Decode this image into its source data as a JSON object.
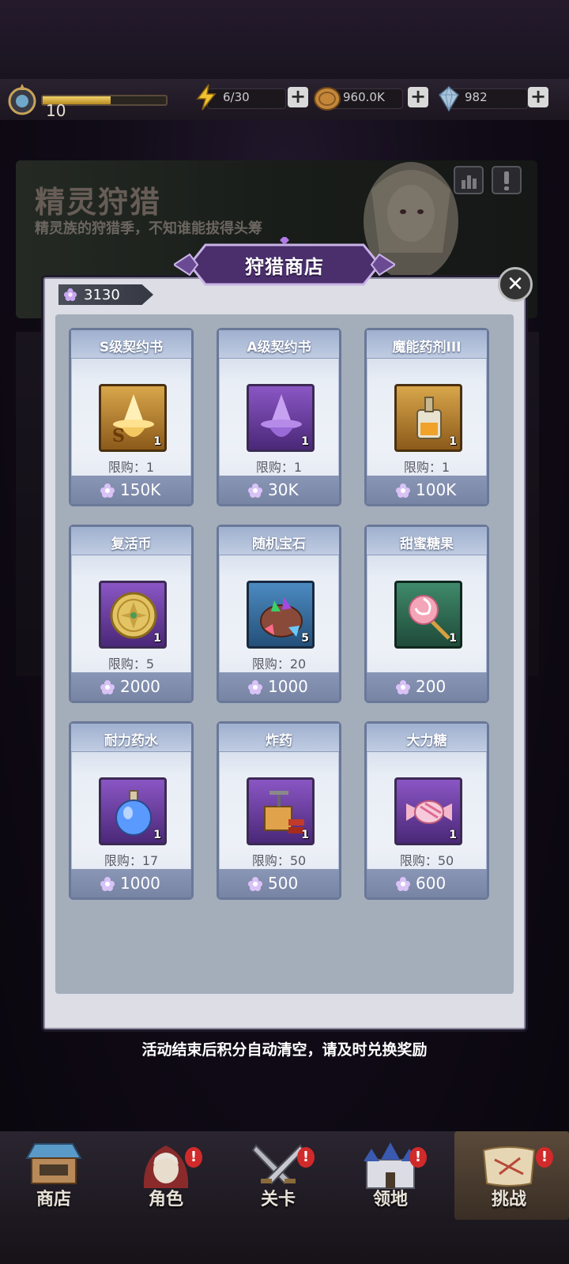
{
  "hud": {
    "level": "10",
    "xp_fraction": 0.55,
    "energy": "6/30",
    "gold": "960.0K",
    "gems": "982"
  },
  "event": {
    "title": "精灵狩猎",
    "subtitle": "精灵族的狩猎季，不知谁能拔得头筹"
  },
  "shop": {
    "title": "狩猎商店",
    "points": "3130",
    "items": [
      {
        "name": "S级契约书",
        "qty": "1",
        "limit": "限购：1",
        "price": "150K",
        "icon": "s-contract-icon"
      },
      {
        "name": "A级契约书",
        "qty": "1",
        "limit": "限购：1",
        "price": "30K",
        "icon": "a-contract-icon"
      },
      {
        "name": "魔能药剂III",
        "qty": "1",
        "limit": "限购：1",
        "price": "100K",
        "icon": "magic-potion-icon"
      },
      {
        "name": "复活币",
        "qty": "1",
        "limit": "限购：5",
        "price": "2000",
        "icon": "revive-coin-icon"
      },
      {
        "name": "随机宝石",
        "qty": "5",
        "limit": "限购：20",
        "price": "1000",
        "icon": "gem-bag-icon"
      },
      {
        "name": "甜蜜糖果",
        "qty": "1",
        "limit": "",
        "price": "200",
        "icon": "lollipop-icon"
      },
      {
        "name": "耐力药水",
        "qty": "1",
        "limit": "限购：17",
        "price": "1000",
        "icon": "stamina-potion-icon"
      },
      {
        "name": "炸药",
        "qty": "1",
        "limit": "限购：50",
        "price": "500",
        "icon": "dynamite-icon"
      },
      {
        "name": "大力糖",
        "qty": "1",
        "limit": "限购：50",
        "price": "600",
        "icon": "candy-icon"
      }
    ],
    "notice": "活动结束后积分自动清空，请及时兑换奖励"
  },
  "nav": {
    "items": [
      {
        "label": "商店"
      },
      {
        "label": "角色"
      },
      {
        "label": "关卡"
      },
      {
        "label": "领地"
      },
      {
        "label": "挑战"
      }
    ],
    "badge": "!"
  },
  "colors": {
    "accent_purple": "#7a4ab8",
    "price_bar": "#7884a4",
    "badge_red": "#d12a2a"
  }
}
